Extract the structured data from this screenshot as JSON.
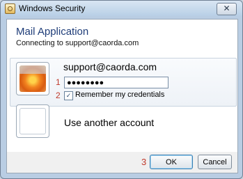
{
  "window": {
    "title": "Windows Security",
    "close_glyph": "✕"
  },
  "header": {
    "app_title": "Mail Application",
    "connecting_text": "Connecting to support@caorda.com"
  },
  "credential": {
    "username": "support@caorda.com",
    "password_masked": "●●●●●●●●",
    "remember_label": "Remember my credentials",
    "remember_checked": true,
    "check_glyph": "✓"
  },
  "other_account": {
    "label": "Use another account"
  },
  "callouts": {
    "password": "1",
    "remember": "2",
    "ok": "3"
  },
  "buttons": {
    "ok": "OK",
    "cancel": "Cancel"
  },
  "icons": {
    "title_icon": "shield-lock-icon",
    "avatar": "flower-avatar-icon",
    "other_avatar": "blank-avatar-icon"
  }
}
